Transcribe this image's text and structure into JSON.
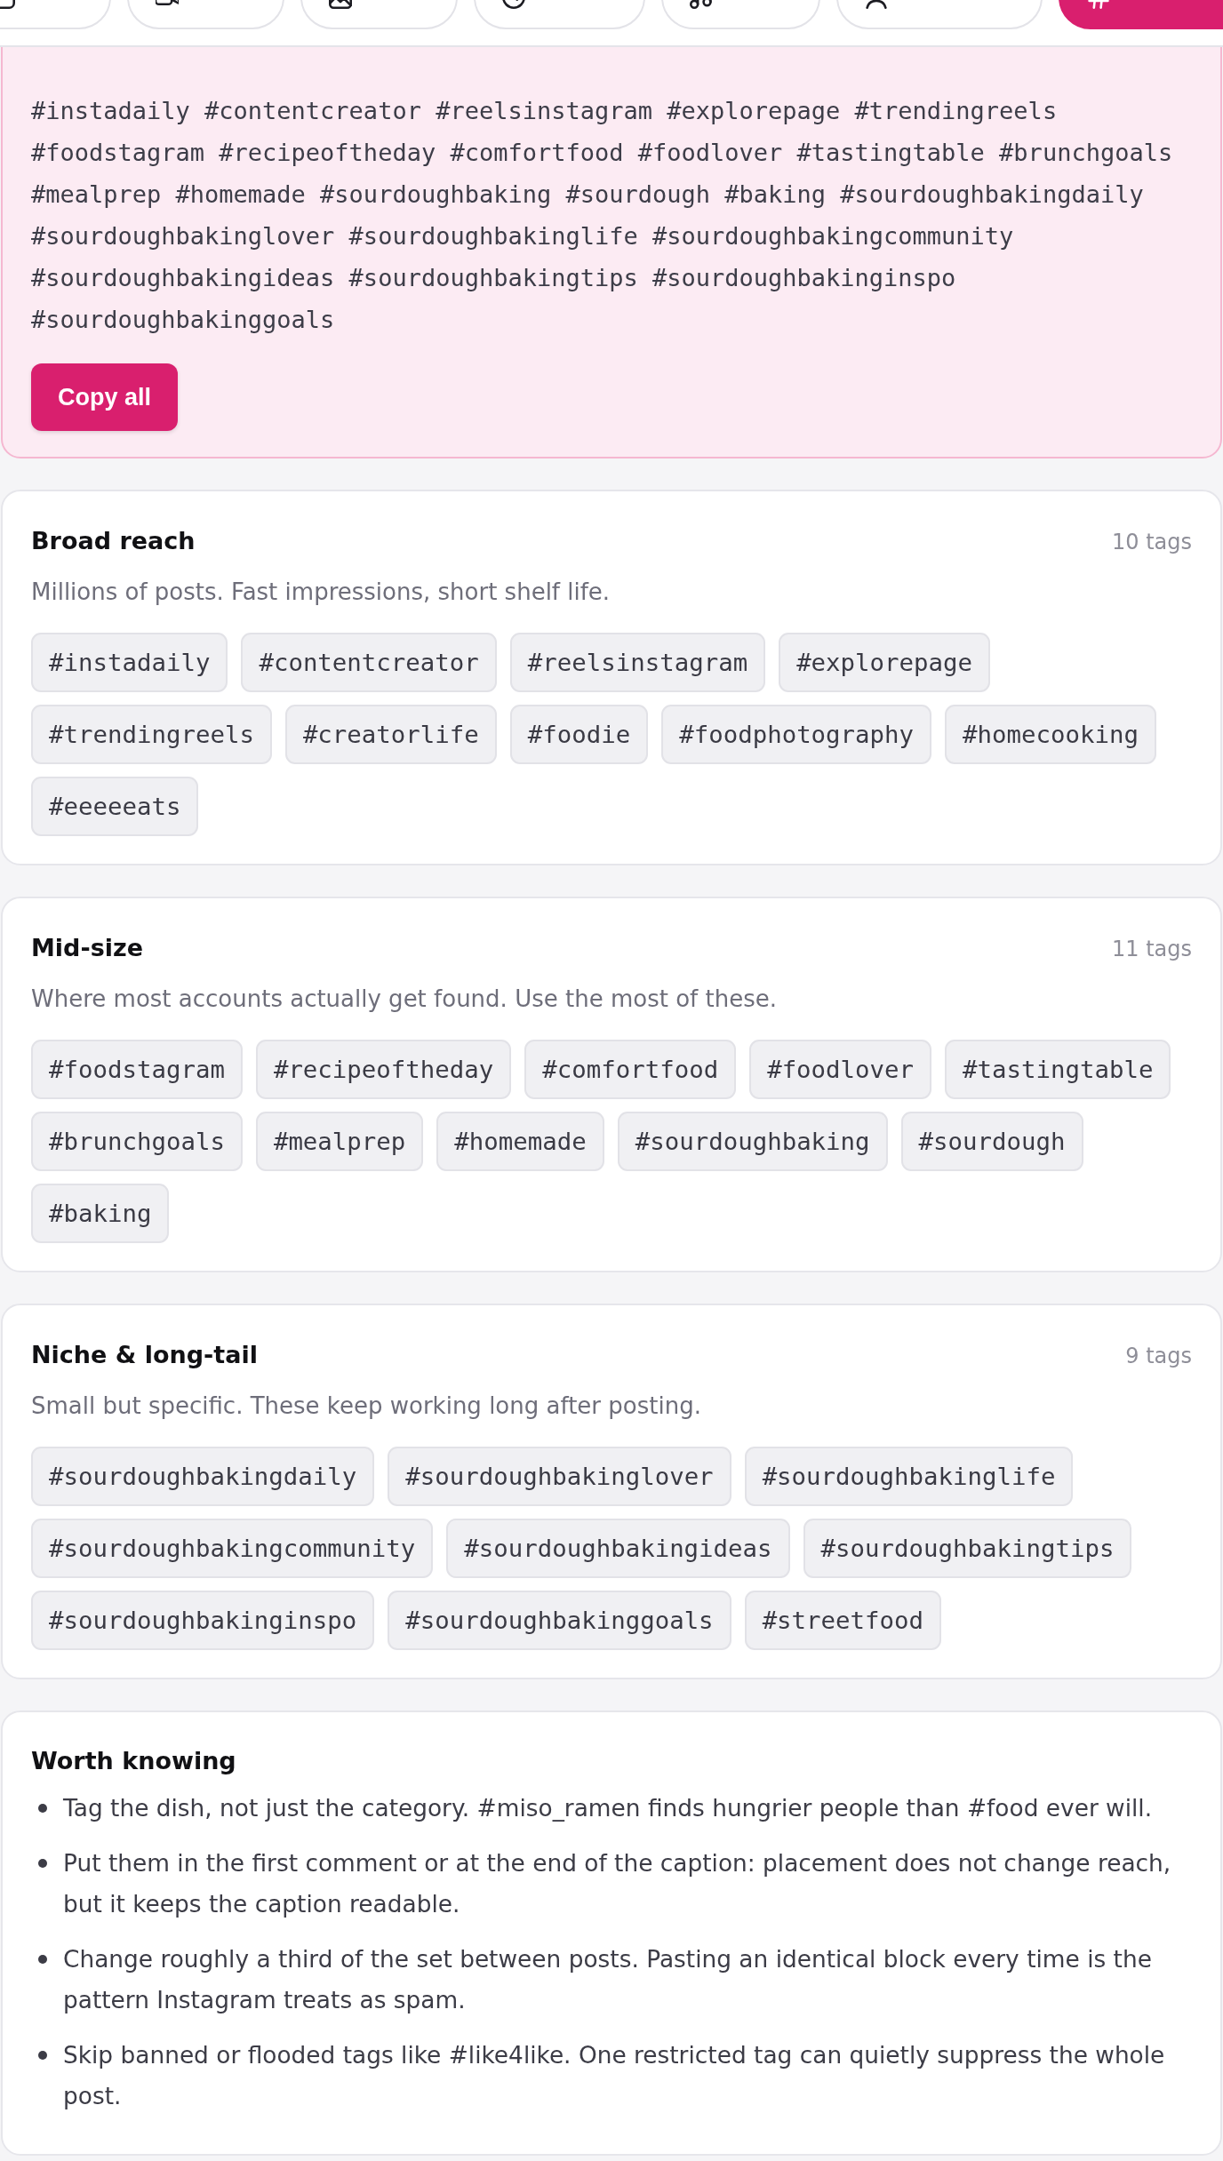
{
  "tabs": [
    {
      "selected": false
    },
    {
      "selected": false
    },
    {
      "selected": false
    },
    {
      "selected": false
    },
    {
      "selected": false
    },
    {
      "selected": false
    },
    {
      "selected": true
    }
  ],
  "balanced_set": {
    "hashtags": "#instadaily #contentcreator #reelsinstagram #explorepage #trendingreels #foodstagram #recipeoftheday #comfortfood #foodlover #tastingtable #brunchgoals #mealprep #homemade #sourdoughbaking #sourdough #baking #sourdoughbakingdaily #sourdoughbakinglover #sourdoughbakinglife #sourdoughbakingcommunity #sourdoughbakingideas #sourdoughbakingtips #sourdoughbakinginspo #sourdoughbakinggoals",
    "copy_button": "Copy all"
  },
  "groups": [
    {
      "title": "Broad reach",
      "count": "10 tags",
      "description": "Millions of posts. Fast impressions, short shelf life.",
      "tags": [
        "#instadaily",
        "#contentcreator",
        "#reelsinstagram",
        "#explorepage",
        "#trendingreels",
        "#creatorlife",
        "#foodie",
        "#foodphotography",
        "#homecooking",
        "#eeeeeats"
      ]
    },
    {
      "title": "Mid-size",
      "count": "11 tags",
      "description": "Where most accounts actually get found. Use the most of these.",
      "tags": [
        "#foodstagram",
        "#recipeoftheday",
        "#comfortfood",
        "#foodlover",
        "#tastingtable",
        "#brunchgoals",
        "#mealprep",
        "#homemade",
        "#sourdoughbaking",
        "#sourdough",
        "#baking"
      ]
    },
    {
      "title": "Niche & long-tail",
      "count": "9 tags",
      "description": "Small but specific. These keep working long after posting.",
      "tags": [
        "#sourdoughbakingdaily",
        "#sourdoughbakinglover",
        "#sourdoughbakinglife",
        "#sourdoughbakingcommunity",
        "#sourdoughbakingideas",
        "#sourdoughbakingtips",
        "#sourdoughbakinginspo",
        "#sourdoughbakinggoals",
        "#streetfood"
      ]
    }
  ],
  "tips": {
    "title": "Worth knowing",
    "items": [
      "Tag the dish, not just the category. #miso_ramen finds hungrier people than #food ever will.",
      "Put them in the first comment or at the end of the caption: placement does not change reach, but it keeps the caption readable.",
      "Change roughly a third of the set between posts. Pasting an identical block every time is the pattern Instagram treats as spam.",
      "Skip banned or flooded tags like #like4like. One restricted tag can quietly suppress the whole post."
    ]
  }
}
